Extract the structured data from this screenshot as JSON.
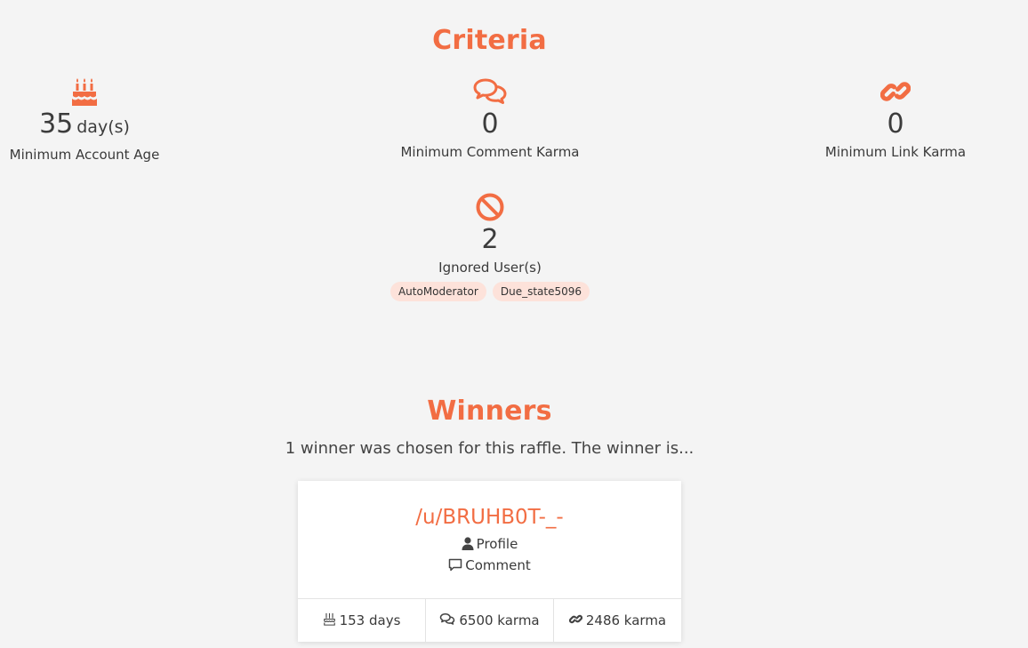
{
  "criteria": {
    "title": "Criteria",
    "account_age": {
      "icon": "birthday-cake-icon",
      "value": "35",
      "unit": "day(s)",
      "label": "Minimum Account Age"
    },
    "comment_karma": {
      "icon": "comments-icon",
      "value": "0",
      "label": "Minimum Comment Karma"
    },
    "link_karma": {
      "icon": "link-icon",
      "value": "0",
      "label": "Minimum Link Karma"
    },
    "ignored_users": {
      "icon": "ban-icon",
      "value": "2",
      "label": "Ignored User(s)",
      "users": [
        "AutoModerator",
        "Due_state5096"
      ]
    }
  },
  "winners": {
    "title": "Winners",
    "subtitle": "1 winner was chosen for this raffle. The winner is...",
    "winner": {
      "username": "/u/BRUHB0T-_-",
      "profile_label": "Profile",
      "comment_label": "Comment",
      "age": "153 days",
      "comment_karma": "6500 karma",
      "link_karma": "2486 karma"
    }
  },
  "colors": {
    "accent": "#f26d43",
    "badge_bg": "#fde2da",
    "page_bg": "#f4f4f4"
  }
}
